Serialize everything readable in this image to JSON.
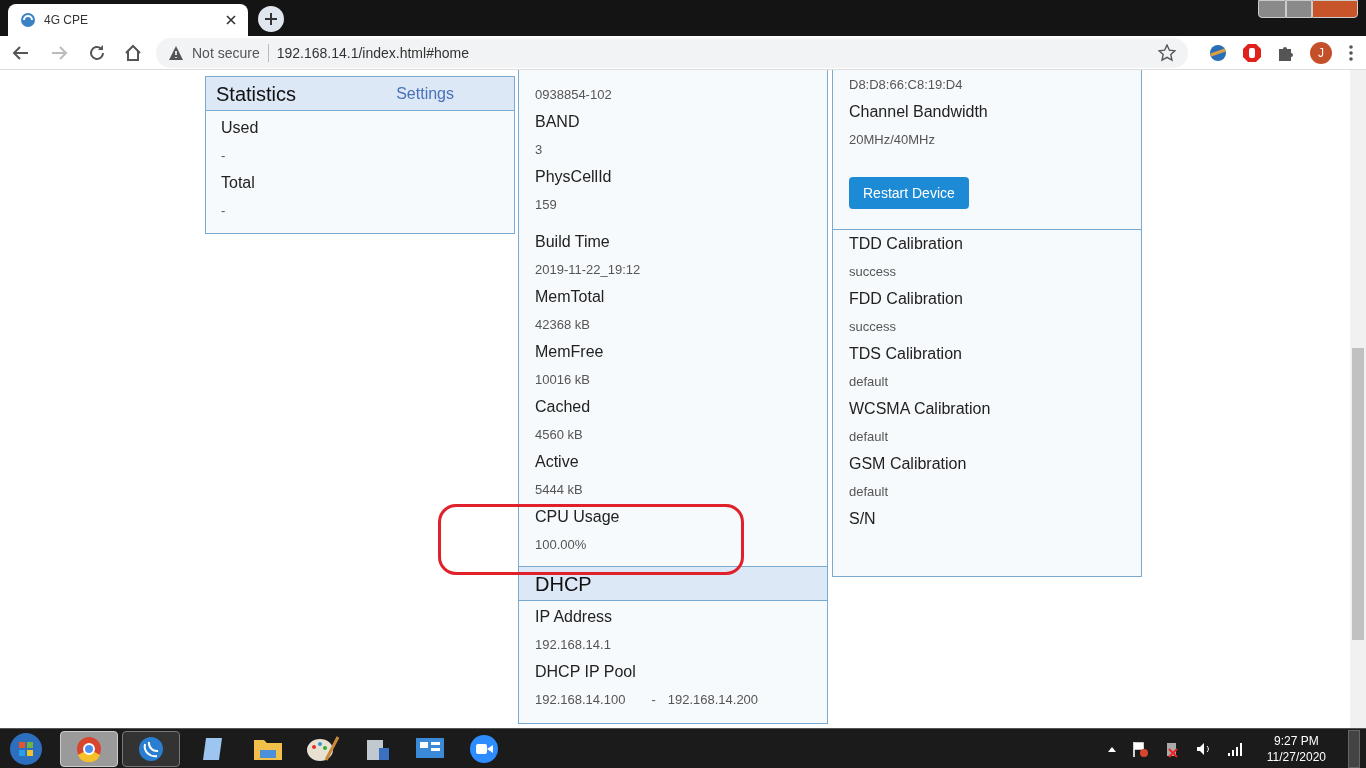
{
  "browser": {
    "tab_title": "4G CPE",
    "security": "Not secure",
    "url": "192.168.14.1/index.html#home",
    "avatar": "J"
  },
  "statistics": {
    "title": "Statistics",
    "link": "Settings",
    "items": [
      {
        "label": "Used",
        "value": "-"
      },
      {
        "label": "Total",
        "value": "-"
      }
    ]
  },
  "device_info": {
    "groups": [
      {
        "items": [
          {
            "value": "0938854-102"
          },
          {
            "label": "BAND",
            "value": "3"
          },
          {
            "label": "PhysCellId",
            "value": "159"
          }
        ]
      },
      {
        "items": [
          {
            "label": "Build Time",
            "value": "2019-11-22_19:12"
          },
          {
            "label": "MemTotal",
            "value": "42368 kB"
          },
          {
            "label": "MemFree",
            "value": "10016 kB"
          },
          {
            "label": "Cached",
            "value": "4560 kB"
          },
          {
            "label": "Active",
            "value": "5444 kB"
          },
          {
            "label": "CPU Usage",
            "value": "100.00%"
          }
        ]
      }
    ]
  },
  "dhcp": {
    "title": "DHCP",
    "items": [
      {
        "label": "IP Address",
        "value": "192.168.14.1"
      },
      {
        "label": "DHCP IP Pool",
        "value": "192.168.14.100",
        "separator": "-",
        "value_end": "192.168.14.200"
      }
    ]
  },
  "system": {
    "groups": [
      {
        "items": [
          {
            "value": "D8:D8:66:C8:19:D4"
          },
          {
            "label": "Channel Bandwidth",
            "value": "20MHz/40MHz"
          }
        ],
        "button": "Restart Device"
      },
      {
        "items": [
          {
            "label": "TDD Calibration",
            "value": "success"
          },
          {
            "label": "FDD Calibration",
            "value": "success"
          },
          {
            "label": "TDS Calibration",
            "value": "default"
          },
          {
            "label": "WCSMA Calibration",
            "value": "default"
          },
          {
            "label": "GSM Calibration",
            "value": "default"
          },
          {
            "label": "S/N"
          }
        ]
      }
    ]
  },
  "taskbar": {
    "time": "9:27 PM",
    "date": "11/27/2020"
  }
}
